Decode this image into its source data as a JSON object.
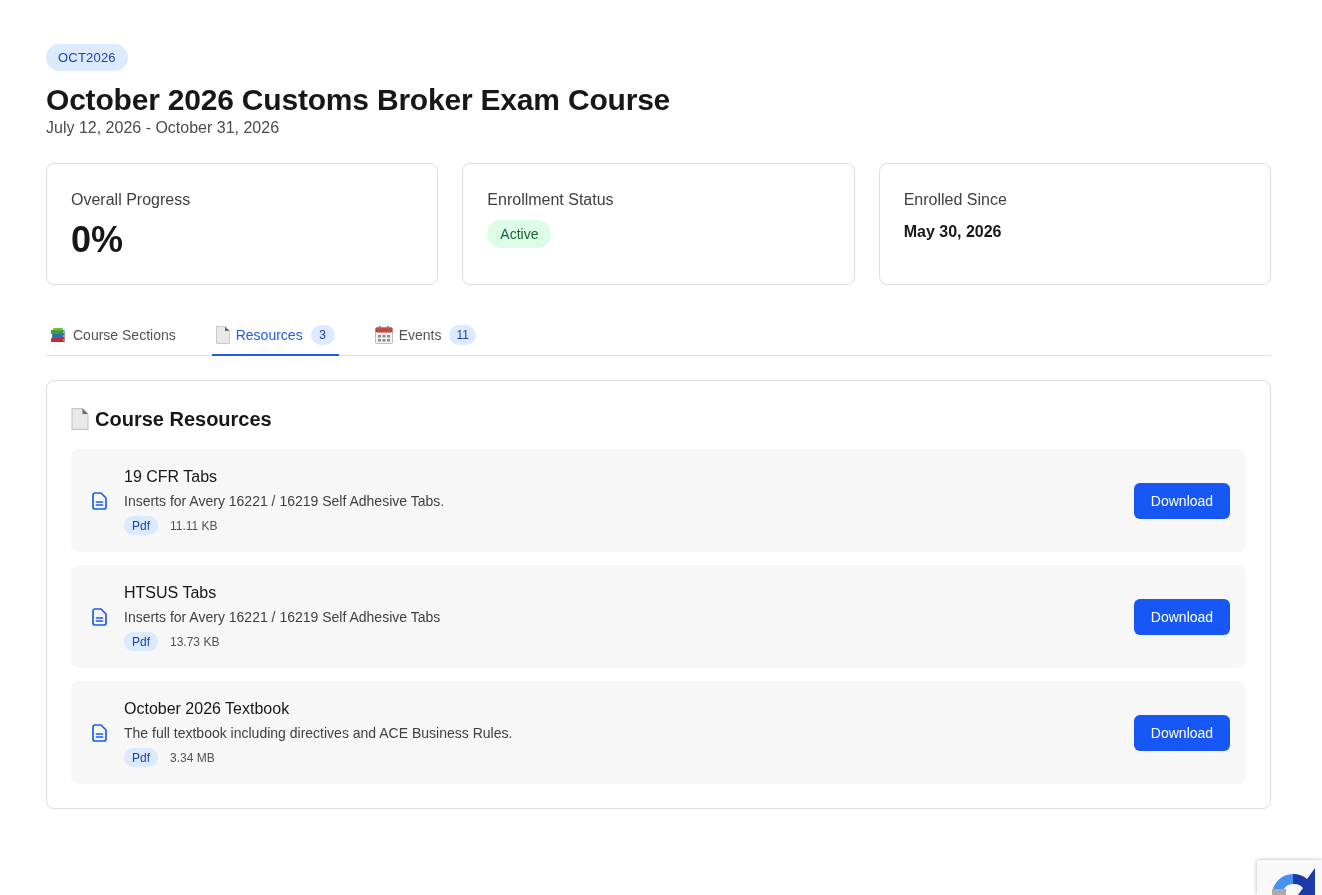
{
  "course": {
    "code": "OCT2026",
    "title": "October 2026 Customs Broker Exam Course",
    "dates": "July 12, 2026 - October 31, 2026"
  },
  "stats": [
    {
      "kind": "number",
      "label": "Overall Progress",
      "value": "0%"
    },
    {
      "kind": "status",
      "label": "Enrollment Status",
      "value": "Active"
    },
    {
      "kind": "date",
      "label": "Enrolled Since",
      "value": "May 30, 2026"
    }
  ],
  "tabs": [
    {
      "label": "Course Sections",
      "selected": false
    },
    {
      "label": "Resources",
      "count": "3",
      "selected": true
    },
    {
      "label": "Events",
      "count": "11",
      "selected": false
    }
  ],
  "resources_panel": {
    "title": "Course Resources",
    "items": [
      {
        "title": "19 CFR Tabs",
        "description": "Inserts for Avery 16221 / 16219 Self Adhesive Tabs.",
        "file_type": "Pdf",
        "size": "11.11 KB",
        "action": "Download"
      },
      {
        "title": "HTSUS Tabs",
        "description": "Inserts for Avery 16221 / 16219 Self Adhesive Tabs",
        "file_type": "Pdf",
        "size": "13.73 KB",
        "action": "Download"
      },
      {
        "title": "October 2026 Textbook",
        "description": "The full textbook including directives and ACE Business Rules.",
        "file_type": "Pdf",
        "size": "3.34 MB",
        "action": "Download"
      }
    ]
  }
}
